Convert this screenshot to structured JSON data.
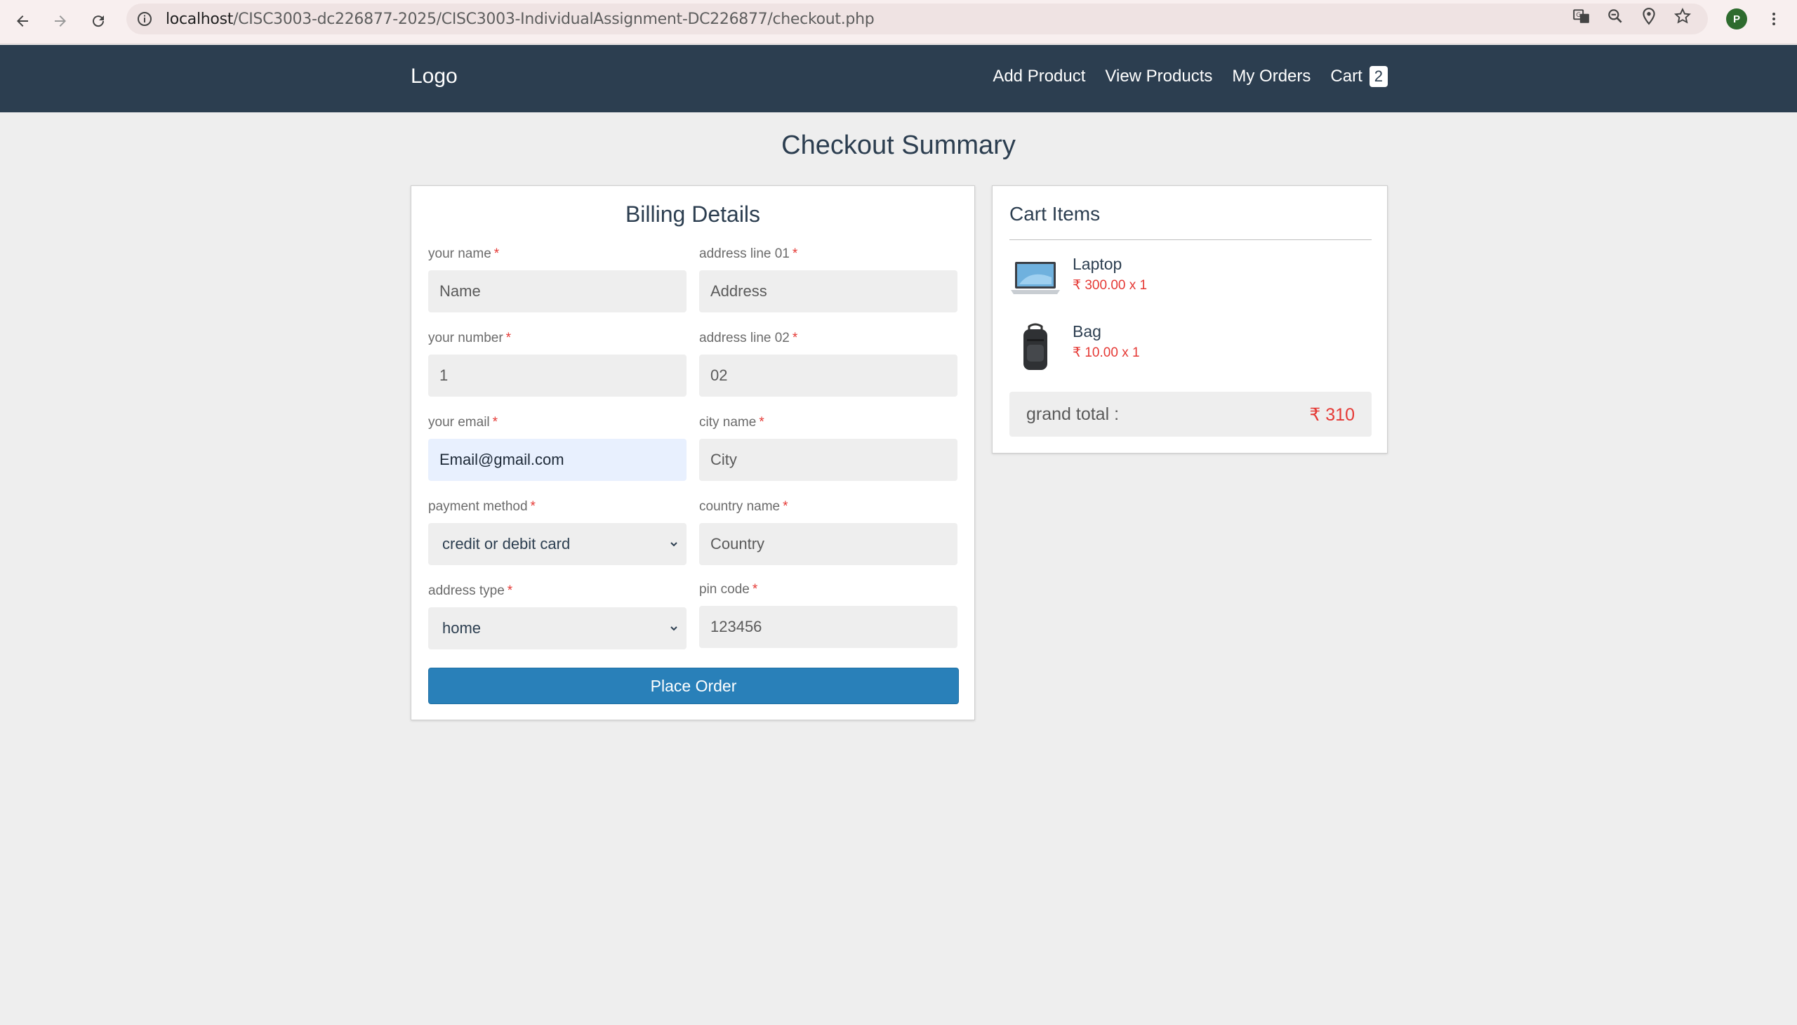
{
  "browser": {
    "url_host": "localhost",
    "url_path": "/CISC3003-dc226877-2025/CISC3003-IndividualAssignment-DC226877/checkout.php",
    "profile_initial": "P"
  },
  "header": {
    "logo": "Logo",
    "nav": {
      "add_product": "Add Product",
      "view_products": "View Products",
      "my_orders": "My Orders",
      "cart": "Cart",
      "cart_count": "2"
    }
  },
  "page_title": "Checkout Summary",
  "billing": {
    "title": "Billing Details",
    "required_mark": "*",
    "fields": {
      "name": {
        "label": "your name",
        "value": "Name"
      },
      "address1": {
        "label": "address line 01",
        "value": "Address"
      },
      "number": {
        "label": "your number",
        "value": "1"
      },
      "address2": {
        "label": "address line 02",
        "value": "02"
      },
      "email": {
        "label": "your email",
        "value": "Email@gmail.com"
      },
      "city": {
        "label": "city name",
        "value": "City"
      },
      "payment": {
        "label": "payment method",
        "value": "credit or debit card"
      },
      "country": {
        "label": "country name",
        "value": "Country"
      },
      "address_type": {
        "label": "address type",
        "value": "home"
      },
      "pin": {
        "label": "pin code",
        "value": "123456"
      }
    },
    "submit_label": "Place Order"
  },
  "cart": {
    "title": "Cart Items",
    "items": [
      {
        "name": "Laptop",
        "price": "₹ 300.00 x 1",
        "image": "laptop-image"
      },
      {
        "name": "Bag",
        "price": "₹ 10.00 x 1",
        "image": "backpack-image"
      }
    ],
    "grand_total_label": "grand total :",
    "grand_total_value": "₹ 310"
  },
  "colors": {
    "header_bg": "#2c3e50",
    "page_bg": "#eeeeee",
    "accent_button": "#2980b9",
    "price_red": "#e53935"
  }
}
